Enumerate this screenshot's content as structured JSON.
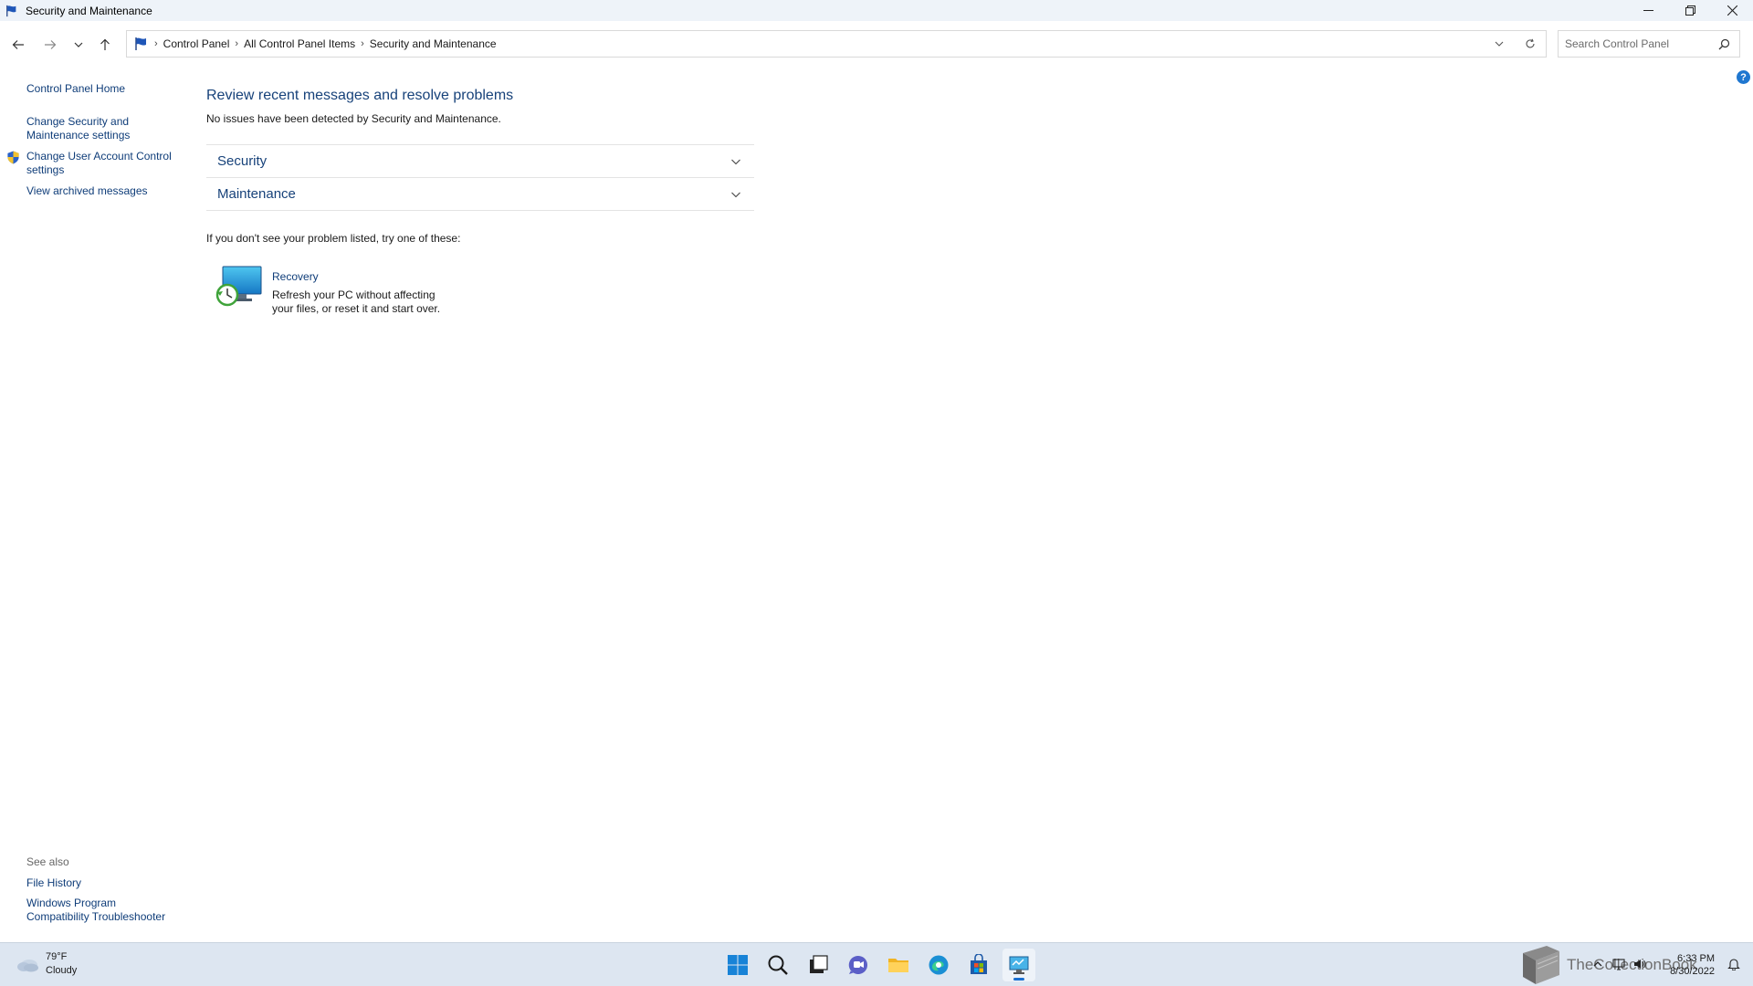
{
  "window": {
    "title": "Security and Maintenance",
    "controls": {
      "minimize": "minimize",
      "restore": "restore",
      "close": "close"
    }
  },
  "address": {
    "breadcrumbs": [
      "Control Panel",
      "All Control Panel Items",
      "Security and Maintenance"
    ],
    "search_placeholder": "Search Control Panel"
  },
  "sidebar": {
    "home": "Control Panel Home",
    "change_security": "Change Security and Maintenance settings",
    "change_uac": "Change User Account Control settings",
    "archived": "View archived messages",
    "see_also_label": "See also",
    "file_history": "File History",
    "compat": "Windows Program Compatibility Troubleshooter"
  },
  "main": {
    "heading": "Review recent messages and resolve problems",
    "status": "No issues have been detected by Security and Maintenance.",
    "sections": [
      "Security",
      "Maintenance"
    ],
    "try_text": "If you don't see your problem listed, try one of these:",
    "recovery": {
      "title": "Recovery",
      "description": "Refresh your PC without affecting your files, or reset it and start over."
    }
  },
  "taskbar": {
    "weather_temp": "79°F",
    "weather_desc": "Cloudy",
    "overlay_text": "TheCollectionBook",
    "time": "6:33 PM",
    "date": "8/30/2022"
  },
  "colors": {
    "link": "#0f3d79",
    "heading": "#17427a",
    "taskbar": "#dde6f1"
  }
}
